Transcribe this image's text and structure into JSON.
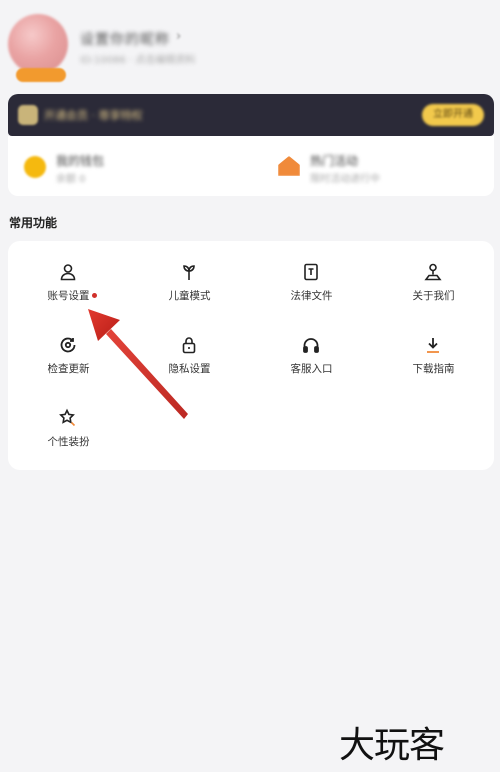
{
  "profile": {
    "nickname": "设置你的昵称",
    "user_id": "ID:10086 · 点击编辑资料"
  },
  "vip_banner": {
    "text": "开通会员 · 尊享特权",
    "button_label": "立即开通"
  },
  "stats": {
    "left": {
      "title": "我的钱包",
      "subtitle": "余额 0"
    },
    "right": {
      "title": "热门活动",
      "subtitle": "限时活动进行中"
    }
  },
  "section": {
    "title": "常用功能"
  },
  "functions": {
    "items": [
      {
        "label": "账号设置",
        "icon": "person-icon",
        "badge": true
      },
      {
        "label": "儿童模式",
        "icon": "sprout-icon"
      },
      {
        "label": "法律文件",
        "icon": "document-icon"
      },
      {
        "label": "关于我们",
        "icon": "location-person-icon"
      },
      {
        "label": "检查更新",
        "icon": "refresh-circle-icon"
      },
      {
        "label": "隐私设置",
        "icon": "lock-icon"
      },
      {
        "label": "客服入口",
        "icon": "headphones-icon"
      },
      {
        "label": "下载指南",
        "icon": "download-icon"
      },
      {
        "label": "个性装扮",
        "icon": "star-brush-icon"
      }
    ]
  },
  "watermark": {
    "text": "大玩客"
  },
  "colors": {
    "accent_red": "#d0302b",
    "vip_dark": "#2b2a38",
    "vip_gold": "#f2c94c",
    "arrow_red": "#d42a24"
  }
}
